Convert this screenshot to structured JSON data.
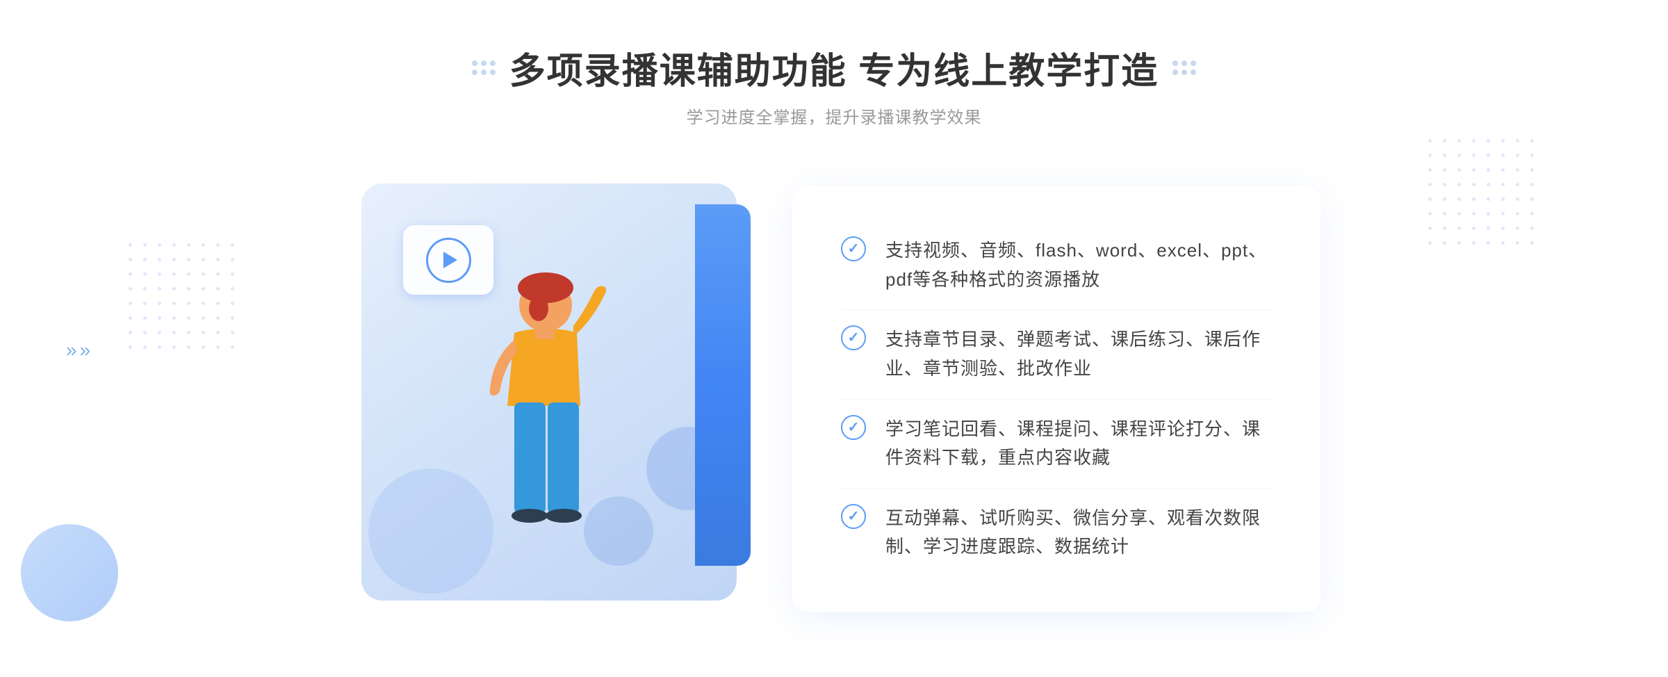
{
  "header": {
    "main_title": "多项录播课辅助功能 专为线上教学打造",
    "subtitle": "学习进度全掌握，提升录播课教学效果"
  },
  "features": [
    {
      "id": "feature-1",
      "text": "支持视频、音频、flash、word、excel、ppt、pdf等各种格式的资源播放"
    },
    {
      "id": "feature-2",
      "text": "支持章节目录、弹题考试、课后练习、课后作业、章节测验、批改作业"
    },
    {
      "id": "feature-3",
      "text": "学习笔记回看、课程提问、课程评论打分、课件资料下载，重点内容收藏"
    },
    {
      "id": "feature-4",
      "text": "互动弹幕、试听购买、微信分享、观看次数限制、学习进度跟踪、数据统计"
    }
  ],
  "decoration": {
    "check_symbol": "✓",
    "play_button_label": "play"
  },
  "colors": {
    "primary_blue": "#4a85e8",
    "light_blue": "#7aabf5",
    "title_color": "#333333",
    "subtitle_color": "#999999",
    "text_color": "#444444",
    "check_color": "#5b9cf6"
  }
}
